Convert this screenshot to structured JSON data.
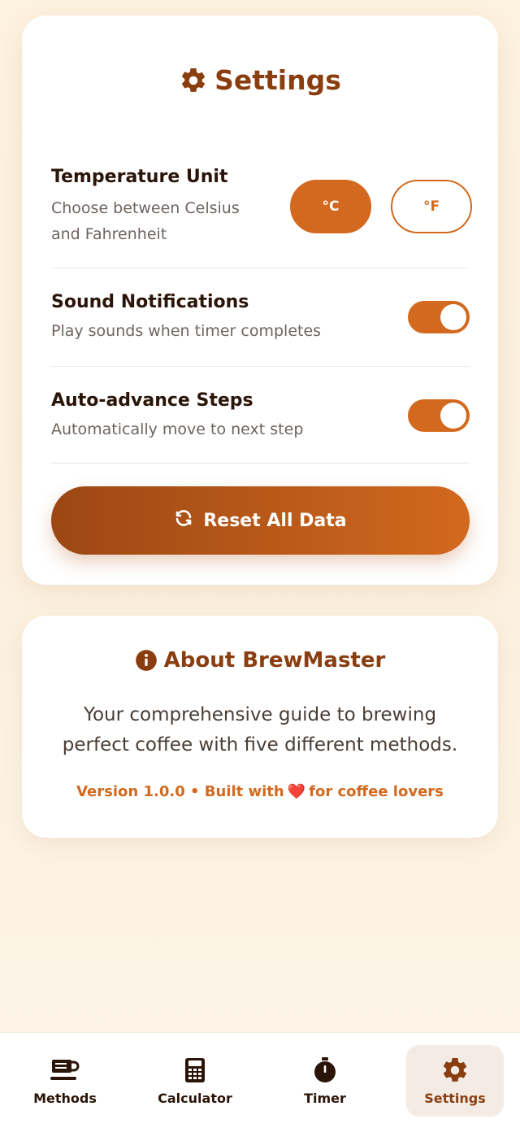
{
  "settings": {
    "title": "Settings",
    "temperature": {
      "label": "Temperature Unit",
      "description": "Choose between Celsius and Fahrenheit",
      "options": [
        "°C",
        "°F"
      ],
      "selected": "°C"
    },
    "sound": {
      "label": "Sound Notifications",
      "description": "Play sounds when timer completes",
      "enabled": true
    },
    "auto_advance": {
      "label": "Auto-advance Steps",
      "description": "Automatically move to next step",
      "enabled": true
    },
    "reset_label": "Reset All Data"
  },
  "about": {
    "title": "About BrewMaster",
    "description": "Your comprehensive guide to brewing perfect coffee with five different methods.",
    "version_prefix": "Version 1.0.0 • Built with",
    "version_suffix": "for coffee lovers"
  },
  "nav": {
    "items": [
      {
        "label": "Methods",
        "icon": "coffee-cup-icon",
        "active": false
      },
      {
        "label": "Calculator",
        "icon": "calculator-icon",
        "active": false
      },
      {
        "label": "Timer",
        "icon": "stopwatch-icon",
        "active": false
      },
      {
        "label": "Settings",
        "icon": "gear-icon",
        "active": true
      }
    ]
  },
  "colors": {
    "accent": "#d2691e",
    "title": "#8a3e10",
    "background": "#fdf1df"
  }
}
